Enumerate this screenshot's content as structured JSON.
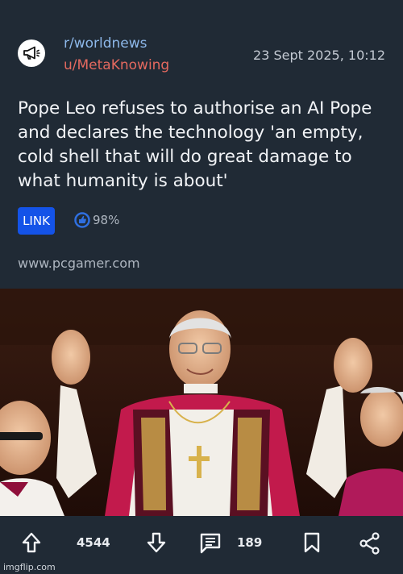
{
  "post": {
    "subreddit": "r/worldnews",
    "author": "u/MetaKnowing",
    "timestamp": "23 Sept 2025, 10:12",
    "title": "Pope Leo refuses to authorise an AI Pope and declares the technology 'an empty, cold shell that will do great damage to what humanity is about'",
    "link_label": "LINK",
    "upvote_ratio": "98%",
    "domain": "www.pcgamer.com"
  },
  "footer": {
    "upvote_count": "4544",
    "comment_count": "189"
  },
  "watermark": "imgflip.com",
  "icons": [
    "megaphone-icon",
    "thumb-up-icon",
    "upvote-arrow-icon",
    "downvote-arrow-icon",
    "comment-icon",
    "bookmark-icon",
    "share-icon"
  ],
  "colors": {
    "background": "#202a35",
    "subreddit": "#8db8ea",
    "author": "#e4695f",
    "link_badge": "#1453e8",
    "ratio_icon": "#2f6fe0"
  }
}
